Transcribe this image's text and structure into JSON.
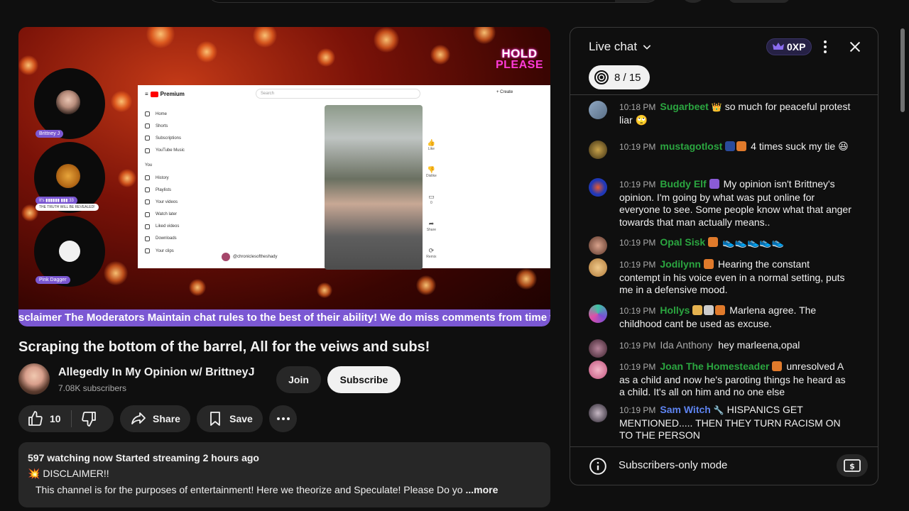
{
  "video": {
    "overlay_line1": "HOLD",
    "overlay_line2": "PLEASE",
    "participants": [
      {
        "name": "Brittney J"
      },
      {
        "name": "It's ▮▮▮▮▮▮ ▮▮▮:33",
        "sub": "THE TRUTH WILL BE REVEALED!"
      },
      {
        "name": "Pink Dagger"
      }
    ],
    "screen": {
      "brand": "Premium",
      "search_placeholder": "Search",
      "create": "+ Create",
      "sidebar": [
        "Home",
        "Shorts",
        "Subscriptions",
        "YouTube Music",
        "You",
        "History",
        "Playlists",
        "Your videos",
        "Watch later",
        "Liked videos",
        "Downloads",
        "Your clips"
      ],
      "actions": [
        "Like",
        "Dislike",
        "0",
        "Share",
        "Remix"
      ],
      "channel": "@chroniclesoftheshady"
    },
    "ticker": "sclaimer The Moderators Maintain chat rules to the best of their ability! We do miss comments from time to"
  },
  "title": "Scraping the bottom of the barrel, All for the veiws and subs!",
  "channel": {
    "name": "Allegedly In My Opinion w/ BrittneyJ",
    "subscribers": "7.08K subscribers",
    "join_label": "Join",
    "subscribe_label": "Subscribe"
  },
  "actions": {
    "like_count": "10",
    "share_label": "Share",
    "save_label": "Save"
  },
  "description": {
    "meta": "597 watching now  Started streaming 2 hours ago",
    "line2": "DISCLAIMER!!",
    "line2_emoji": "💥",
    "line3": "This channel is for the purposes of entertainment!  Here we theorize and Speculate!  Please Do yo",
    "more": "...more"
  },
  "chat": {
    "title": "Live chat",
    "xp": "0XP",
    "goal": "8 / 15",
    "footer": "Subscribers-only mode",
    "messages": [
      {
        "time": "10:18 PM",
        "author": "Sugarbeet",
        "text": "so much for peaceful protest liar 🙄"
      },
      {
        "time": "10:19 PM",
        "author": "mustagotlost",
        "text": "4 times suck my tie 😆"
      },
      {
        "time": "10:19 PM",
        "author": "Buddy Elf",
        "text": "My opinion isn't Brittney's opinion. I'm going by what was put online for everyone to see. Some people know what that anger towards that man actually means.."
      },
      {
        "time": "10:19 PM",
        "author": "Opal Sisk",
        "text": "👟👟👟👟👟"
      },
      {
        "time": "10:19 PM",
        "author": "Jodilynn",
        "text": "Hearing the constant contempt in his voice even in a normal setting, puts me in a defensive mood."
      },
      {
        "time": "10:19 PM",
        "author": "Hollys",
        "text": "Marlena agree. The childhood cant be used as excuse."
      },
      {
        "time": "10:19 PM",
        "author": "Ida Anthony",
        "text": "hey marleena,opal"
      },
      {
        "time": "10:19 PM",
        "author": "Joan The Homesteader",
        "text": "unresolved A as a child and now he's paroting things he heard as a child. It's all on him and no one else"
      },
      {
        "time": "10:19 PM",
        "author": "Sam Witch",
        "text": "HISPANICS GET MENTIONED..... THEN THEY TURN RACISM ON TO THE PERSON"
      }
    ]
  },
  "colors": {
    "background": "#0f0f0f",
    "accent_purple": "#7b58d3",
    "author_green": "#2ba640",
    "author_blue": "#5e84f1"
  }
}
